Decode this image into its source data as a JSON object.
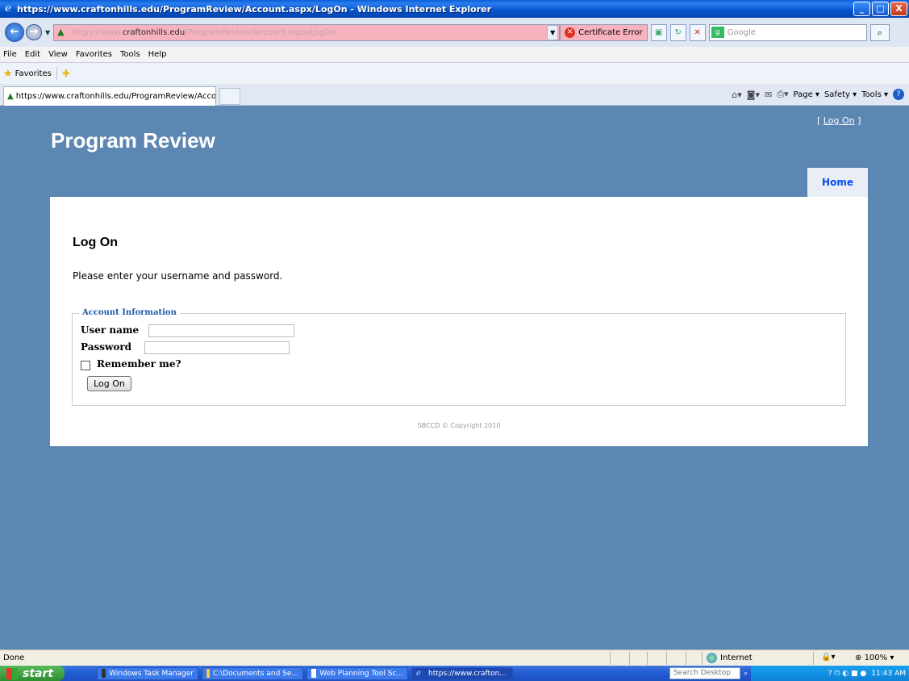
{
  "window": {
    "title": "https://www.craftonhills.edu/ProgramReview/Account.aspx/LogOn - Windows Internet Explorer",
    "controls": [
      "_",
      "□",
      "X"
    ]
  },
  "address_bar": {
    "url_prefix": "https://www.",
    "url_domain": "craftonhills.edu",
    "url_path": "/ProgramReview/Account.aspx/LogOn",
    "cert_error": "Certificate Error",
    "search_placeholder": "Google"
  },
  "menu": {
    "items": [
      "File",
      "Edit",
      "View",
      "Favorites",
      "Tools",
      "Help"
    ]
  },
  "favorites_bar": {
    "label": "Favorites"
  },
  "tabs": {
    "active_title": "https://www.craftonhills.edu/ProgramReview/Accoun..."
  },
  "command_bar": {
    "page": "Page",
    "safety": "Safety",
    "tools": "Tools"
  },
  "site": {
    "title": "Program Review",
    "login_prefix": "[ ",
    "login_link": "Log On",
    "login_suffix": " ]",
    "nav_home": "Home",
    "heading": "Log On",
    "intro": "Please enter your username and password.",
    "fieldset_legend": "Account Information",
    "username_label": "User name",
    "username_value": "",
    "password_label": "Password",
    "password_value": "",
    "remember_label": "Remember me?",
    "remember_checked": false,
    "submit_label": "Log On",
    "footer": "SBCCD © Copyright 2010"
  },
  "status_bar": {
    "status": "Done",
    "zone": "Internet",
    "zoom": "100%"
  },
  "taskbar": {
    "start": "start",
    "tasks": [
      {
        "label": "Windows Task Manager",
        "active": false
      },
      {
        "label": "C:\\Documents and Se...",
        "active": false
      },
      {
        "label": "Web Planning Tool Sc...",
        "active": false
      },
      {
        "label": "https://www.crafton...",
        "active": true
      }
    ],
    "search_placeholder": "Search Desktop",
    "clock": "11:43 AM"
  },
  "colors": {
    "page_bg": "#5c87b2",
    "link_blue": "#034af3",
    "titlebar": "#0753c9"
  }
}
